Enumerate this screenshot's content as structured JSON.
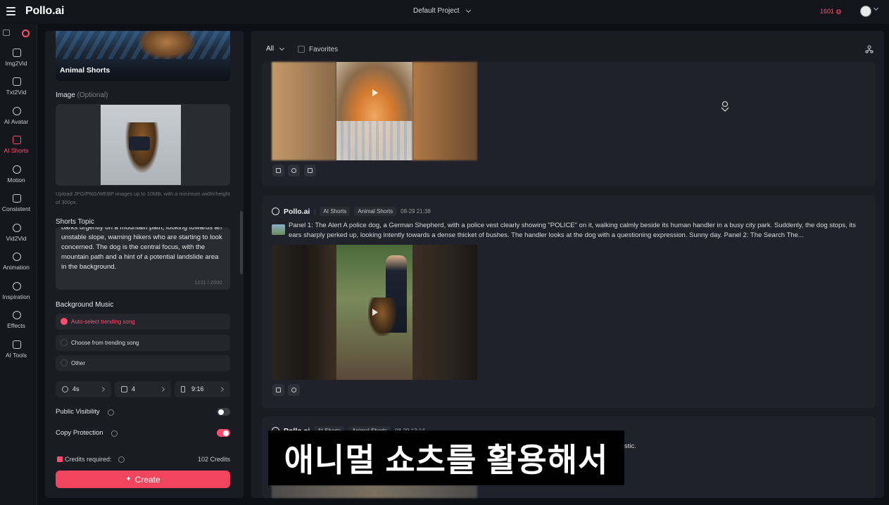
{
  "topbar": {
    "brand": "Pollo.ai",
    "project": "Default Project",
    "credits": "1601"
  },
  "nav": {
    "items": [
      {
        "label": "Img2Vid",
        "icon": "image-to-video-icon"
      },
      {
        "label": "Txt2Vid",
        "icon": "text-to-video-icon"
      },
      {
        "label": "AI Avatar",
        "icon": "avatar-icon"
      },
      {
        "label": "AI Shorts",
        "icon": "shorts-icon",
        "active": true
      },
      {
        "label": "Motion",
        "icon": "motion-icon"
      },
      {
        "label": "Consistent",
        "icon": "consistent-icon"
      },
      {
        "label": "Vid2Vid",
        "icon": "video-to-video-icon"
      },
      {
        "label": "Animation",
        "icon": "animation-icon"
      },
      {
        "label": "Inspiration",
        "icon": "compass-icon"
      },
      {
        "label": "Effects",
        "icon": "effects-icon"
      },
      {
        "label": "AI Tools",
        "icon": "tools-icon"
      }
    ]
  },
  "panel": {
    "banner_label": "Animal Shorts",
    "image_label": "Image",
    "image_optional": "(Optional)",
    "upload_hint": "Upload JPG/PNG/WEBP images up to 10MB, with a minimum width/height of 300px.",
    "topic_label": "Shorts Topic",
    "topic_text": "barks urgently on a mountain path, looking towards an unstable slope, warning hikers who are starting to look concerned. The dog is the central focus, with the mountain path and a hint of a potential landslide area in the background.",
    "topic_counter": "1221 / 2000",
    "music_label": "Background Music",
    "music_options": [
      {
        "label": "Auto-select trending song",
        "selected": true
      },
      {
        "label": "Choose from trending song",
        "selected": false
      },
      {
        "label": "Other",
        "selected": false
      }
    ],
    "params": {
      "duration": "4s",
      "count": "4",
      "ratio": "9:16"
    },
    "public_visibility_label": "Public Visibility",
    "public_visibility": false,
    "copy_protection_label": "Copy Protection",
    "copy_protection": true,
    "credits_label": "Credits required:",
    "credits_value": "102 Credits",
    "create_label": "Create"
  },
  "main": {
    "filter": "All",
    "favorites_label": "Favorites",
    "posts": [
      {
        "brand": "Pollo.ai",
        "tags": [
          "AI Shorts",
          "Animal Shorts"
        ],
        "time": "08-29 21:38",
        "text": "Panel 1: The Alert A police dog, a German Shepherd, with a police vest clearly showing \"POLICE\" on it, walking calmly beside its human handler in a busy city park. Suddenly, the dog stops, its ears sharply perked up, looking intently towards a dense thicket of bushes. The handler looks at the dog with a questioning expression. Sunny day. Panel 2: The Search The..."
      },
      {
        "brand": "Pollo.ai",
        "tags": [
          "AI Shorts",
          "Animal Shorts"
        ],
        "time": "08-29 13:14",
        "text": "stic."
      }
    ]
  },
  "subtitle": "애니멀 쇼츠를 활용해서",
  "colors": {
    "accent": "#f1455f",
    "background": "#0f1015",
    "panel": "#1b1c23"
  }
}
